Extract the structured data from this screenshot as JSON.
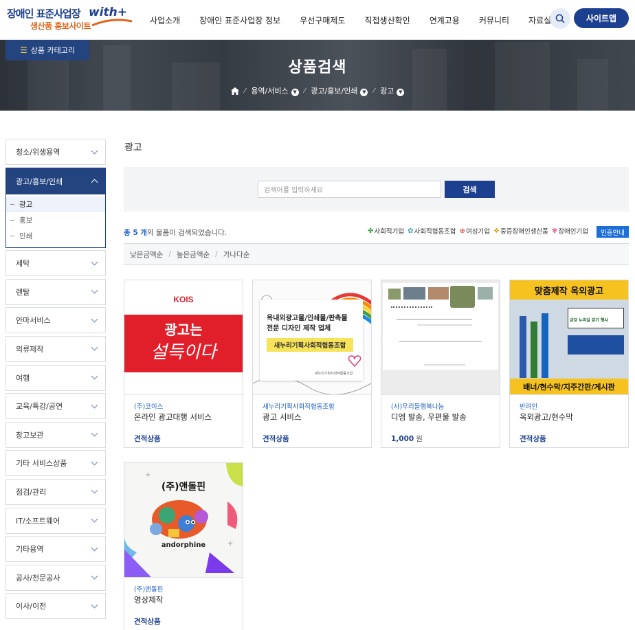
{
  "header": {
    "logo": {
      "line1": "장애인 표준사업장",
      "brand": "with+",
      "line2": "생산품 홍보사이트"
    },
    "nav": [
      "사업소개",
      "장애인 표준사업장 정보",
      "우선구매제도",
      "직접생산확인",
      "연계고용",
      "커뮤니티",
      "자료실"
    ],
    "search_icon": "search-icon",
    "sitemap_label": "사이트맵"
  },
  "banner": {
    "category_button": "상품 카테고리",
    "title": "상품검색",
    "breadcrumb": [
      "용역/서비스",
      "광고/홍보/인쇄",
      "광고"
    ]
  },
  "sidebar": {
    "items_before": [
      {
        "label": "청소/위생용역"
      }
    ],
    "active": {
      "label": "광고/홍보/인쇄",
      "children": [
        {
          "label": "광고",
          "selected": true
        },
        {
          "label": "홍보"
        },
        {
          "label": "인쇄"
        }
      ]
    },
    "items_after": [
      {
        "label": "세탁"
      },
      {
        "label": "렌탈"
      },
      {
        "label": "안마서비스"
      },
      {
        "label": "의류제작"
      },
      {
        "label": "여행"
      },
      {
        "label": "교육/특강/공연"
      },
      {
        "label": "창고보관"
      },
      {
        "label": "기타 서비스상품"
      },
      {
        "label": "점검/관리"
      },
      {
        "label": "IT/소프트웨어"
      },
      {
        "label": "기타용역"
      },
      {
        "label": "공사/전문공사"
      },
      {
        "label": "이사/이전"
      }
    ]
  },
  "main": {
    "title": "광고",
    "search": {
      "placeholder": "검색어를 입력하세요",
      "button": "검색"
    },
    "result": {
      "count": "총 5 개",
      "suffix": "의 물품이 검색되었습니다."
    },
    "badges": [
      {
        "icon": "✤",
        "label": "사회적기업",
        "color": "#3aa14b"
      },
      {
        "icon": "✿",
        "label": "사회적협동조합",
        "color": "#3aa3b0"
      },
      {
        "icon": "⊕",
        "label": "여성기업",
        "color": "#d9342b"
      },
      {
        "icon": "❖",
        "label": "중증장애인생산품",
        "color": "#e0a11b"
      },
      {
        "icon": "✾",
        "label": "장애인기업",
        "color": "#e04a8a"
      }
    ],
    "cert_button": "인증안내",
    "sort": [
      "낮은금액순",
      "높은금액순",
      "가나다순"
    ]
  },
  "products": [
    {
      "company": "(주)코이스",
      "name": "온라인 광고대행 서비스",
      "price": "견적상품",
      "won": "",
      "thumb": {
        "brand": "KOIS",
        "slogan_1": "광고는",
        "slogan_2": "설득이다"
      }
    },
    {
      "company": "새누리기획사회적협동조합",
      "name": "광고 서비스",
      "price": "견적상품",
      "won": "",
      "thumb": {
        "line1": "옥내외광고물/인쇄물/판촉물",
        "line2": "전문 디자인 제작 업체",
        "line3": "새누리기획사회적협동조합",
        "small": "새누리기획사회적협동조합"
      }
    },
    {
      "company": "(사)우리들행복나눔",
      "name": "디엠 발송, 우편물 발송",
      "price": "1,000",
      "won": "원",
      "thumb": {}
    },
    {
      "company": "반려인",
      "name": "옥외광고/현수막",
      "price": "견적상품",
      "won": "",
      "thumb": {
        "top": "맞춤제작 옥외광고",
        "bottom": "배너/현수막/지주간판/게시판",
        "sign": "금강 누리길 걷기 행사"
      }
    },
    {
      "company": "(주)앤돌핀",
      "name": "영상제작",
      "price": "견적상품",
      "won": "",
      "thumb": {
        "title": "(주)앤돌핀",
        "brand": "andorphine"
      }
    }
  ]
}
